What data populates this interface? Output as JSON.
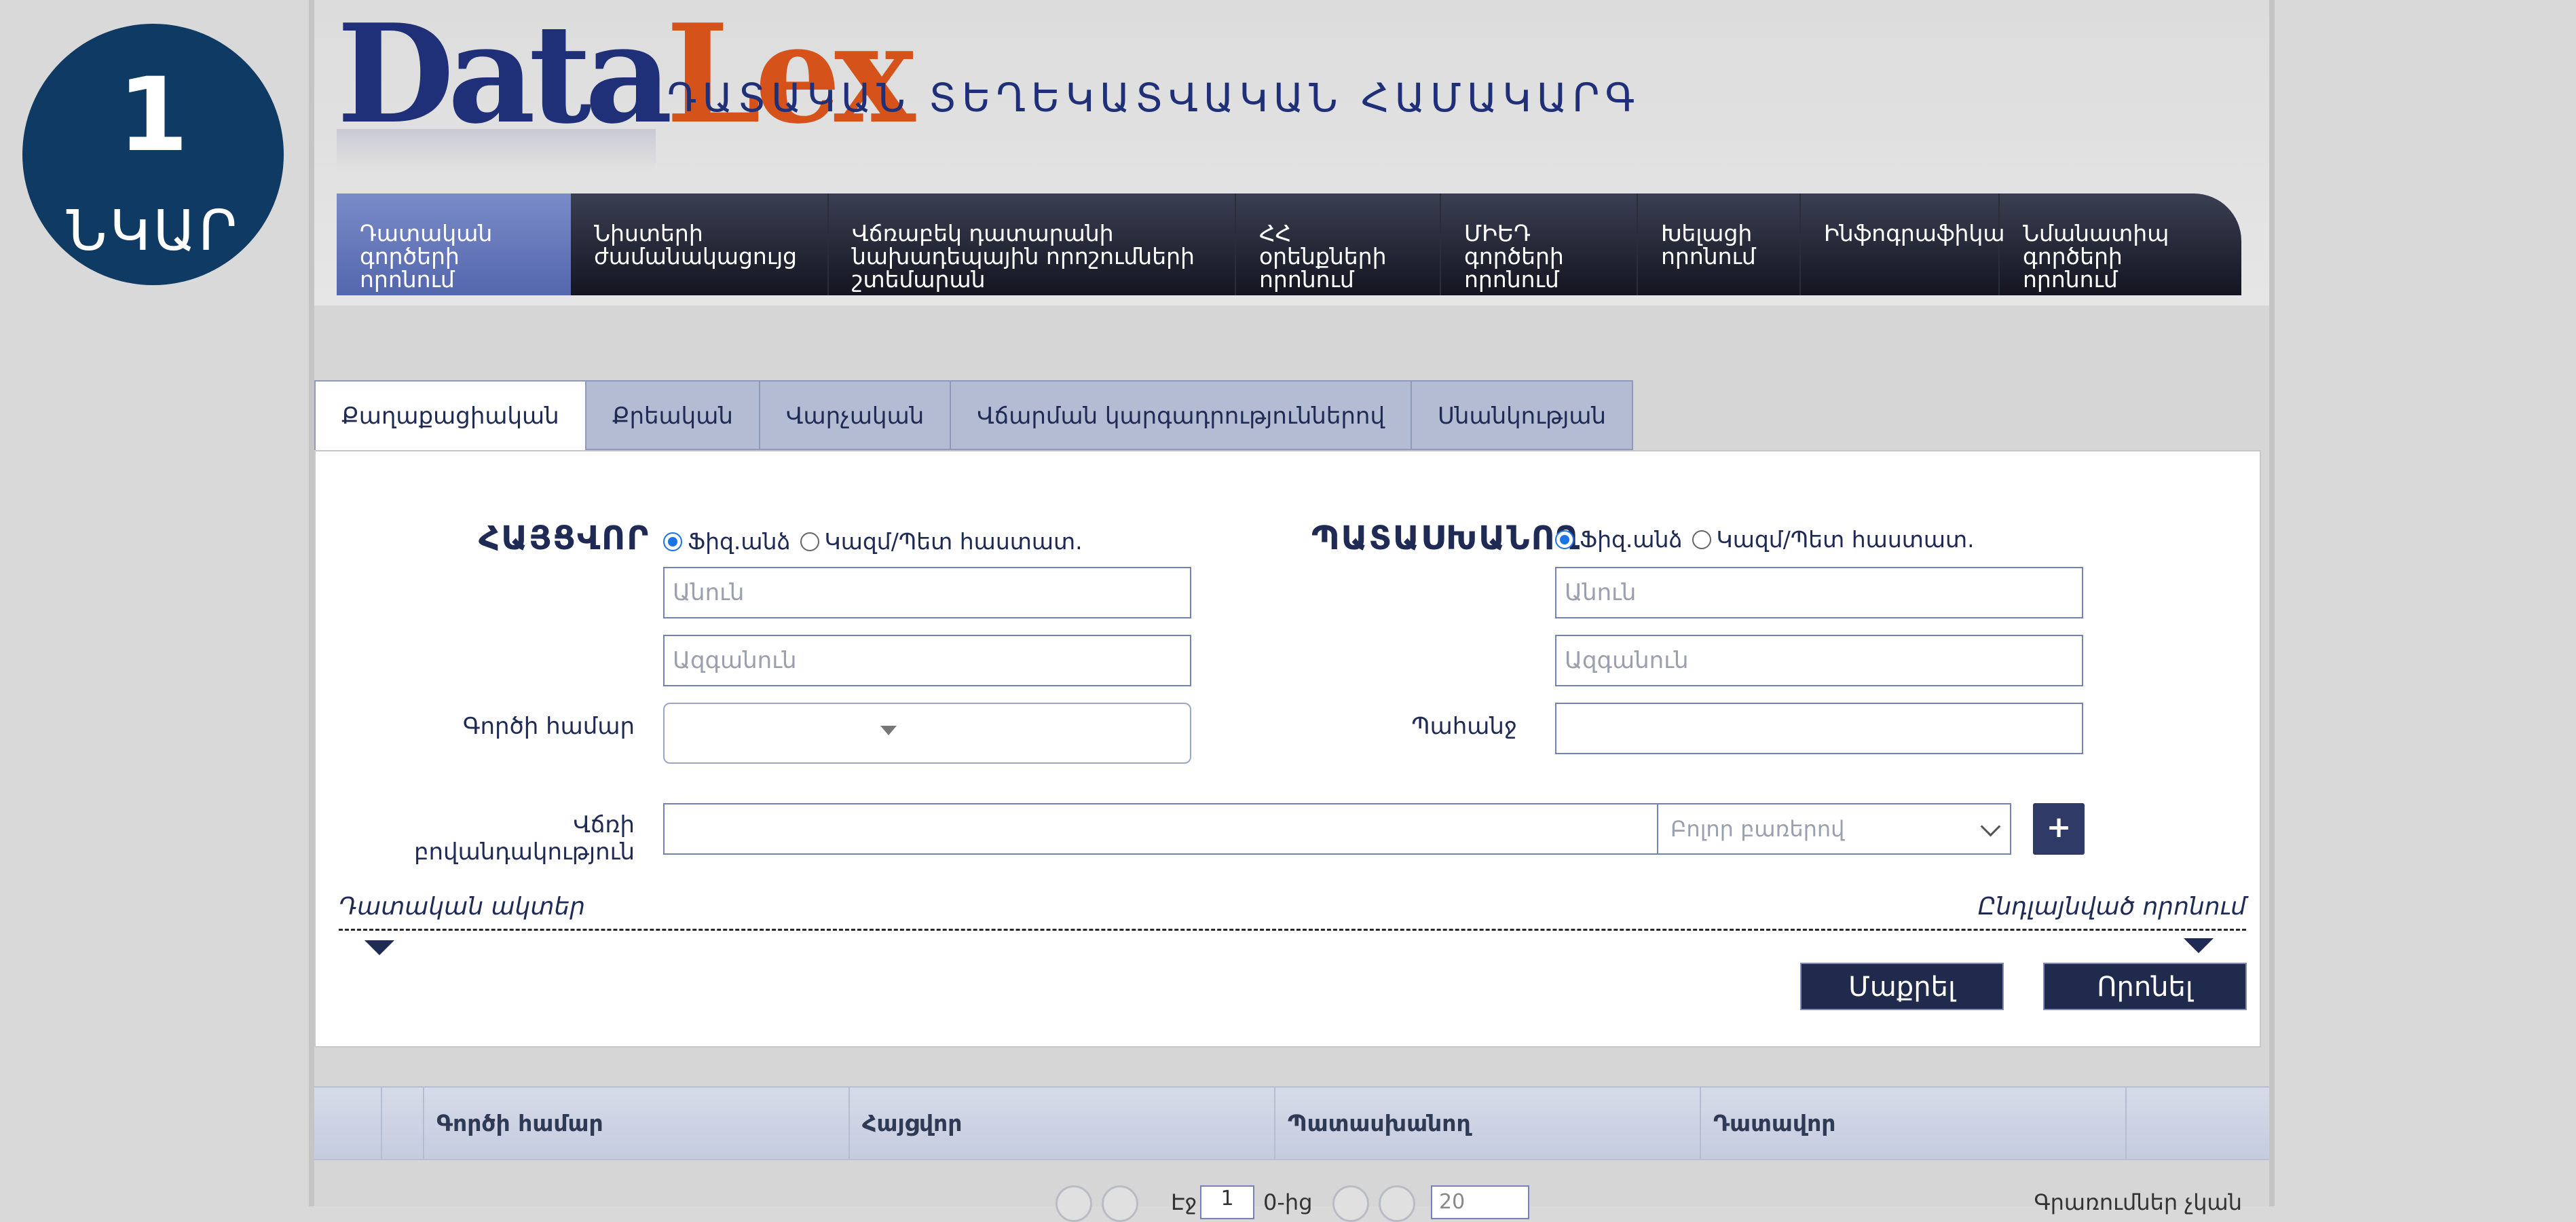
{
  "badge": {
    "number": "1",
    "label": "ՆԿԱՐ"
  },
  "header": {
    "logo_part1": "Data",
    "logo_part2": "Lex",
    "system_title": "ԴԱՏԱԿԱՆ ՏԵՂԵԿԱՏՎԱԿԱՆ ՀԱՄԱԿԱՐԳ"
  },
  "nav": {
    "items": [
      {
        "line1": "Դատական",
        "line2": "գործերի որոնում",
        "line3": ""
      },
      {
        "line1": "Նիստերի",
        "line2": "ժամանակացույց",
        "line3": ""
      },
      {
        "line1": "Վճռաբեկ դատարանի",
        "line2": "նախադեպային որոշումների",
        "line3": "շտեմարան"
      },
      {
        "line1": "ՀՀ օրենքների",
        "line2": "որոնում",
        "line3": ""
      },
      {
        "line1": "ՄԻԵԴ",
        "line2": "գործերի",
        "line3": "որոնում"
      },
      {
        "line1": "Խելացի",
        "line2": "որոնում",
        "line3": ""
      },
      {
        "line1": "Ինֆոգրաֆիկա",
        "line2": "",
        "line3": ""
      },
      {
        "line1": "Նմանատիպ",
        "line2": "գործերի որոնում",
        "line3": ""
      }
    ]
  },
  "tabs": [
    "Քաղաքացիական",
    "Քրեական",
    "Վարչական",
    "Վճարման կարգադրություններով",
    "Սնանկության"
  ],
  "form": {
    "plaintiff_title": "ՀԱՅՑՎՈՐ",
    "defendant_title": "ՊԱՏԱՍԽԱՆՈՂ",
    "radio_physical": "Ֆիզ.անձ",
    "radio_org": "Կազմ/Պետ հաստատ.",
    "first_name_placeholder": "Անուն",
    "last_name_placeholder": "Ազգանուն",
    "case_number_label": "Գործի համար",
    "claim_label": "Պահանջ",
    "verdict_content_label": "Վճռի բովանդակություն",
    "search_mode": "Բոլոր բառերով",
    "plus": "+",
    "judicial_acts": "Դատական ակտեր",
    "advanced_search": "Ընդլայնված որոնում",
    "clear_button": "Մաքրել",
    "search_button": "Որոնել"
  },
  "results": {
    "columns": [
      "Գործի համար",
      "Հայցվոր",
      "Պատասխանող",
      "Դատավոր"
    ]
  },
  "pager": {
    "page_prefix": "Էջ",
    "page_value": "1",
    "page_suffix": "0-ից",
    "page_size": "20",
    "records_text": "Գրառումներ չկան"
  }
}
